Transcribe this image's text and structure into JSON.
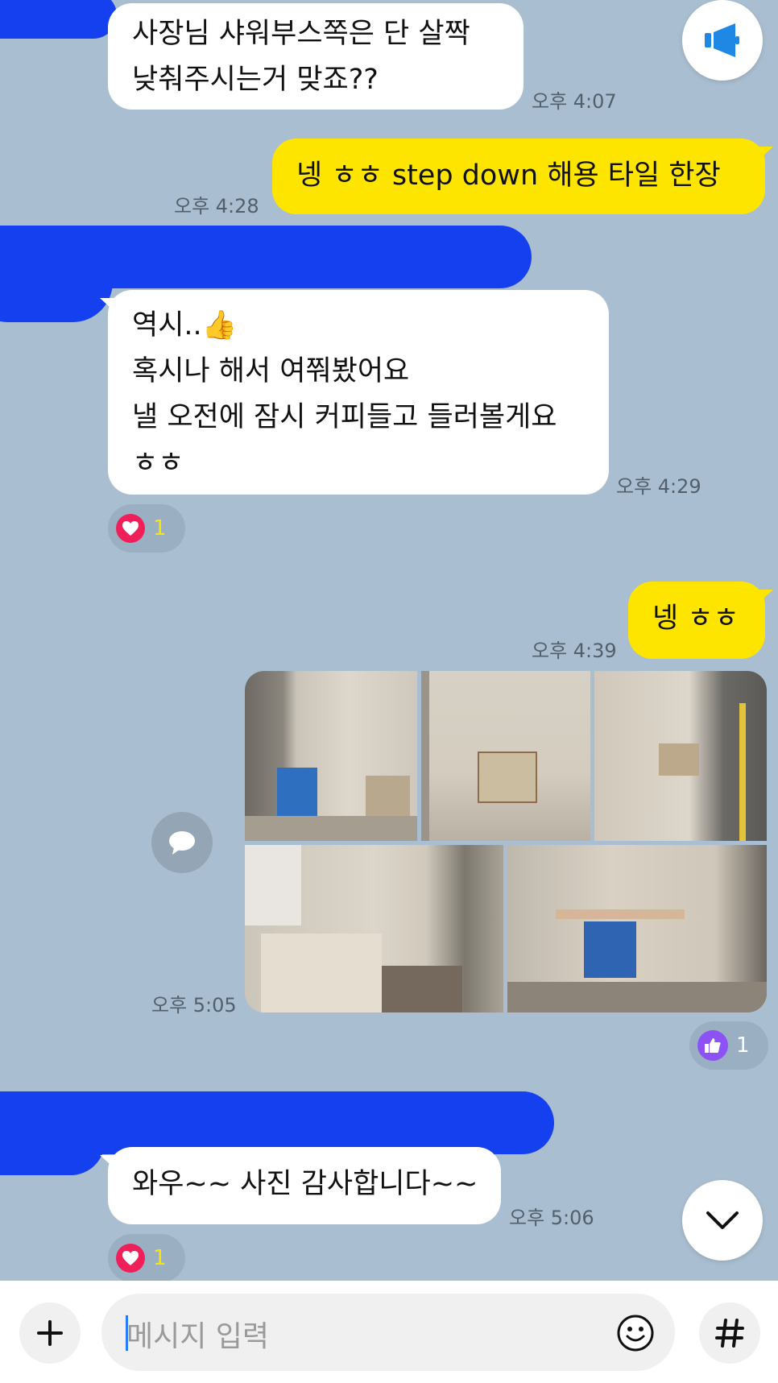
{
  "messages": {
    "m1": {
      "lines": "사장님 샤워부스쪽은 단 살짝\n낮춰주시는거 맞죠??",
      "time": "오후 4:07"
    },
    "m2": {
      "text": "넹 ㅎㅎ step down 해용 타일 한장",
      "time": "오후 4:28"
    },
    "m3": {
      "lines": "역시..👍\n혹시나 해서 여쭤봤어요\n낼 오전에 잠시 커피들고 들러볼게요\nㅎㅎ",
      "time": "오후 4:29",
      "reaction_count": "1"
    },
    "m4": {
      "text": "넹 ㅎㅎ",
      "time": "오후 4:39"
    },
    "m5": {
      "time": "오후 5:05",
      "reaction_count": "1",
      "photo_count": 5
    },
    "m6": {
      "text": "와우~~ 사진 감사합니다~~",
      "time": "오후 5:06",
      "reaction_count": "1"
    }
  },
  "input": {
    "placeholder": "메시지 입력"
  },
  "icons": {
    "notice": "megaphone-icon",
    "share": "speech-bubble-icon",
    "scroll_down": "chevron-down-icon",
    "attach": "plus-icon",
    "emoji": "smiley-icon",
    "hash": "hash-icon"
  },
  "colors": {
    "background": "#a9bed0",
    "outgoing_bubble": "#fee500",
    "incoming_bubble": "#ffffff",
    "redaction": "#1540ef",
    "heart": "#f01f5a",
    "like": "#8d52f5"
  }
}
